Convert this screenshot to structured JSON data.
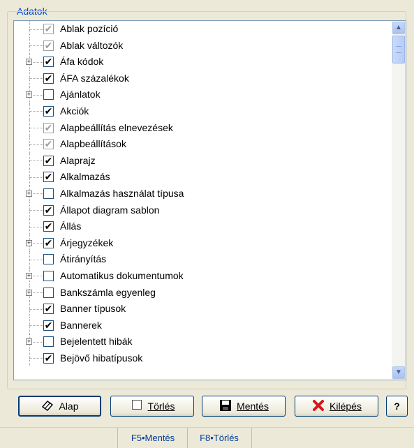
{
  "group": {
    "title": "Adatok"
  },
  "tree": {
    "items": [
      {
        "label": "Ablak pozíció",
        "state": "gray",
        "expandable": false
      },
      {
        "label": "Ablak változók",
        "state": "gray",
        "expandable": false
      },
      {
        "label": "Áfa kódok",
        "state": "checked",
        "expandable": true
      },
      {
        "label": "ÁFA százalékok",
        "state": "checked",
        "expandable": false
      },
      {
        "label": "Ajánlatok",
        "state": "unchecked",
        "expandable": true
      },
      {
        "label": "Akciók",
        "state": "checked",
        "expandable": false
      },
      {
        "label": "Alapbeállítás elnevezések",
        "state": "gray",
        "expandable": false
      },
      {
        "label": "Alapbeállítások",
        "state": "gray",
        "expandable": false
      },
      {
        "label": "Alaprajz",
        "state": "checked",
        "expandable": false
      },
      {
        "label": "Alkalmazás",
        "state": "checked",
        "expandable": false
      },
      {
        "label": "Alkalmazás használat típusa",
        "state": "unchecked",
        "expandable": true
      },
      {
        "label": "Állapot diagram sablon",
        "state": "checked",
        "expandable": false
      },
      {
        "label": "Állás",
        "state": "checked",
        "expandable": false
      },
      {
        "label": "Árjegyzékek",
        "state": "checked",
        "expandable": true
      },
      {
        "label": "Átirányítás",
        "state": "unchecked",
        "expandable": false
      },
      {
        "label": "Automatikus dokumentumok",
        "state": "unchecked",
        "expandable": true
      },
      {
        "label": "Bankszámla egyenleg",
        "state": "unchecked",
        "expandable": true
      },
      {
        "label": "Banner típusok",
        "state": "checked",
        "expandable": false
      },
      {
        "label": "Bannerek",
        "state": "checked",
        "expandable": false
      },
      {
        "label": "Bejelentett hibák",
        "state": "unchecked",
        "expandable": true
      },
      {
        "label": "Bejövő hibatípusok",
        "state": "checked",
        "expandable": false
      }
    ]
  },
  "buttons": {
    "alap": {
      "label": "Alap",
      "icon": "eraser-icon"
    },
    "torles": {
      "label": "Törlés",
      "icon": "checkbox-icon"
    },
    "mentes": {
      "label": "Mentés",
      "icon": "floppy-icon"
    },
    "kilepes": {
      "label": "Kilépés",
      "icon": "x-icon"
    },
    "help": {
      "label": "?"
    }
  },
  "statusbar": {
    "f5": "F5•Mentés",
    "f8": "F8•Törlés"
  },
  "colors": {
    "accent": "#0046d5",
    "exit_icon": "#d11b1b"
  }
}
